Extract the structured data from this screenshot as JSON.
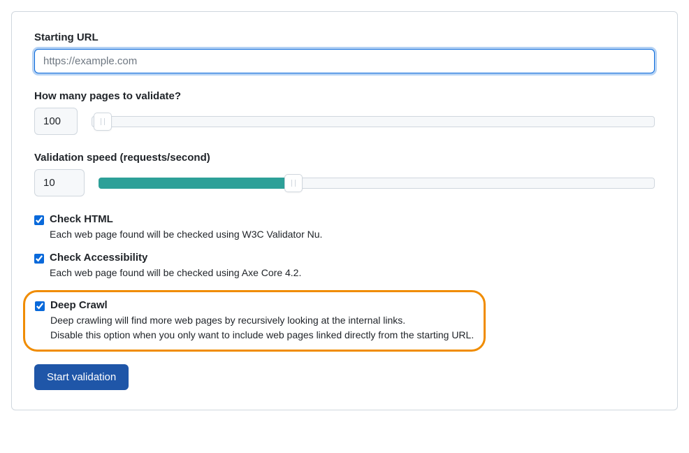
{
  "form": {
    "starting_url": {
      "label": "Starting URL",
      "placeholder": "https://example.com",
      "value": ""
    },
    "pages": {
      "label": "How many pages to validate?",
      "value": "100",
      "slider_percent": 2
    },
    "speed": {
      "label": "Validation speed (requests/second)",
      "value": "10",
      "slider_percent": 35
    },
    "check_html": {
      "label": "Check HTML",
      "description": "Each web page found will be checked using W3C Validator Nu.",
      "checked": true
    },
    "check_accessibility": {
      "label": "Check Accessibility",
      "description": "Each web page found will be checked using Axe Core 4.2.",
      "checked": true
    },
    "deep_crawl": {
      "label": "Deep Crawl",
      "description_line1": "Deep crawling will find more web pages by recursively looking at the internal links.",
      "description_line2": "Disable this option when you only want to include web pages linked directly from the starting URL.",
      "checked": true
    },
    "submit_label": "Start validation"
  }
}
